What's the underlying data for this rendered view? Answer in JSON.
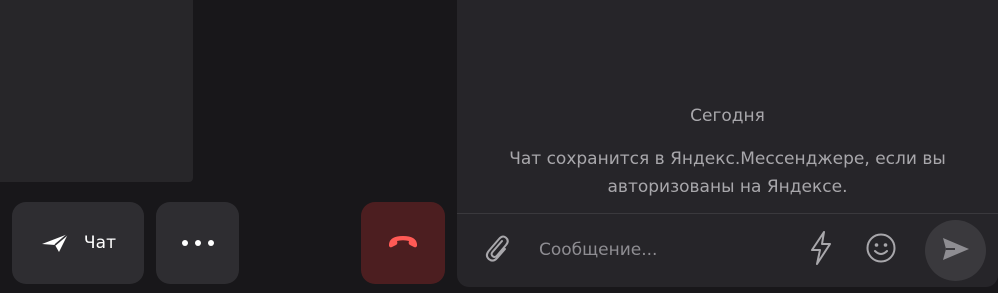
{
  "controls": {
    "chat_label": "Чат",
    "icons": {
      "chat": "paper-plane-icon",
      "more": "three-dots-icon",
      "hangup": "phone-hangup-icon"
    },
    "colors": {
      "button_bg": "#2e2d31",
      "hangup_bg": "#4c1e20",
      "hangup_icon": "#ff5a55"
    }
  },
  "chat": {
    "date_separator": "Сегодня",
    "system_message": "Чат сохранится в Яндекс.Мессенджере, если вы авторизованы на Яндексе.",
    "composer": {
      "placeholder": "Сообщение...",
      "value": "",
      "icons": {
        "attach": "paperclip-icon",
        "quick": "lightning-icon",
        "emoji": "smile-icon",
        "send": "send-arrow-icon"
      }
    }
  }
}
